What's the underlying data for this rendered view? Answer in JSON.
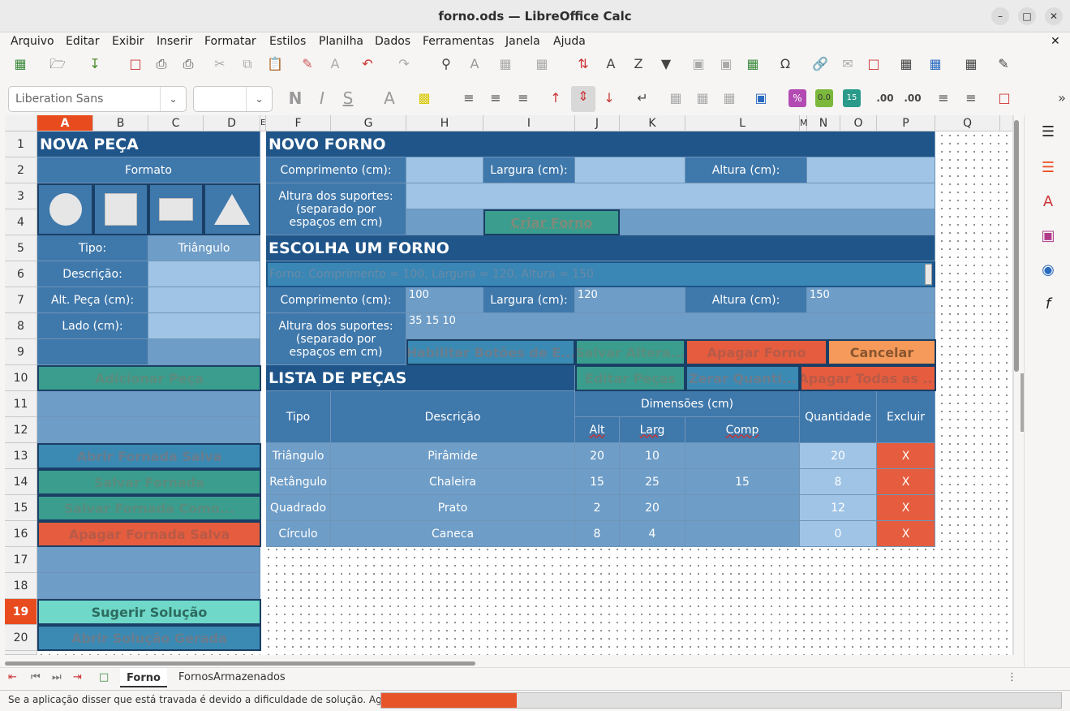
{
  "window": {
    "title": "forno.ods — LibreOffice Calc"
  },
  "menu": [
    "Arquivo",
    "Editar",
    "Exibir",
    "Inserir",
    "Formatar",
    "Estilos",
    "Planilha",
    "Dados",
    "Ferramentas",
    "Janela",
    "Ajuda"
  ],
  "toolbar": {
    "font_name": "Liberation Sans",
    "font_size": ""
  },
  "columns": [
    "A",
    "B",
    "C",
    "D",
    "E",
    "F",
    "G",
    "H",
    "I",
    "J",
    "K",
    "L",
    "M",
    "N",
    "O",
    "P",
    "Q"
  ],
  "rows": [
    "1",
    "2",
    "3",
    "4",
    "5",
    "6",
    "7",
    "8",
    "9",
    "10",
    "11",
    "12",
    "13",
    "14",
    "15",
    "16",
    "17",
    "18",
    "19",
    "20"
  ],
  "active": {
    "column": "A",
    "row": "19"
  },
  "nova_peca": {
    "title": "NOVA PEÇA",
    "formato": "Formato",
    "tipo_label": "Tipo:",
    "tipo_value": "Triângulo",
    "descricao_label": "Descrição:",
    "alt_label": "Alt. Peça (cm):",
    "lado_label": "Lado (cm):",
    "btn_adicionar": "Adicionar Peça",
    "btn_abrir_fornada": "Abrir Fornada Salva",
    "btn_salvar_fornada": "Salvar Fornada",
    "btn_salvar_como": "Salvar Fornada Como...",
    "btn_apagar_fornada": "Apagar Fornada Salva",
    "btn_sugerir": "Sugerir Solução",
    "btn_abrir_solucao": "Abrir Solução Gerada"
  },
  "novo_forno": {
    "title": "NOVO FORNO",
    "comprimento_label": "Comprimento (cm):",
    "largura_label": "Largura (cm):",
    "altura_label": "Altura (cm):",
    "suportes_label": "Altura  dos suportes: (separado por espaços em cm)",
    "btn_criar": "Criar Forno"
  },
  "escolha_forno": {
    "title": "ESCOLHA UM FORNO",
    "combo_value": "Forno: Comprimento = 100, Largura = 120, Altura = 150",
    "comprimento_label": "Comprimento (cm):",
    "comprimento_value": "100",
    "largura_label": "Largura (cm):",
    "largura_value": "120",
    "altura_label": "Altura (cm):",
    "altura_value": "150",
    "suportes_label": "Altura  dos suportes: (separado por espaços em cm)",
    "suportes_value": "35 15 10",
    "btn_habilitar": "Habilitar Botões de E...",
    "btn_salvar_alteracoes": "Salvar Altera...",
    "btn_apagar_forno": "Apagar Forno",
    "btn_cancelar": "Cancelar"
  },
  "lista_pecas": {
    "title": "LISTA DE PEÇAS",
    "btn_editar": "Editar Peças",
    "btn_zerar": "Zerar Quanti...",
    "btn_apagar_todas": "Apagar Todas as ...",
    "headers": {
      "tipo": "Tipo",
      "descricao": "Descrição",
      "dimensoes": "Dimensões (cm)",
      "alt": "Alt",
      "larg": "Larg",
      "comp": "Comp",
      "quantidade": "Quantidade",
      "excluir": "Excluir"
    },
    "rows": [
      {
        "tipo": "Triângulo",
        "descricao": "Pirâmide",
        "alt": "20",
        "larg": "10",
        "comp": "",
        "quantidade": "20",
        "excluir": "X"
      },
      {
        "tipo": "Retângulo",
        "descricao": "Chaleira",
        "alt": "15",
        "larg": "25",
        "comp": "15",
        "quantidade": "8",
        "excluir": "X"
      },
      {
        "tipo": "Quadrado",
        "descricao": "Prato",
        "alt": "2",
        "larg": "20",
        "comp": "",
        "quantidade": "12",
        "excluir": "X"
      },
      {
        "tipo": "Círculo",
        "descricao": "Caneca",
        "alt": "8",
        "larg": "4",
        "comp": "",
        "quantidade": "0",
        "excluir": "X"
      }
    ]
  },
  "sheets": [
    "Forno",
    "FornosArmazenados"
  ],
  "status": {
    "message": "Se a aplicação disser que está travada é  devido a dificuldade de solução. Aguarde..."
  },
  "colors": {
    "dark": "#1f5589",
    "medium": "#3f78ab",
    "light": "#6e9dc7",
    "pale": "#9fc4e6",
    "teal": "#3a9d8e",
    "red": "#e55d3e",
    "orange": "#f59a5a",
    "mint": "#6fd8c8",
    "progress": "#e8542a"
  }
}
